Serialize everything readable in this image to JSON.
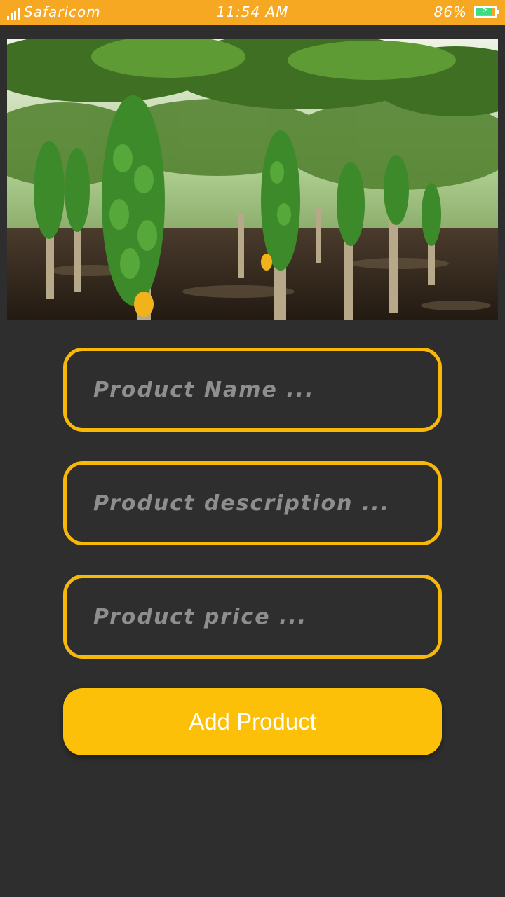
{
  "status_bar": {
    "carrier": "Safaricom",
    "time": "11:54 AM",
    "battery": "86%",
    "battery_level": 0.86,
    "background_color": "#f7a823"
  },
  "hero_image": {
    "subject": "papaya-plantation-photo"
  },
  "form": {
    "product_name_placeholder": "Product Name ...",
    "product_name_value": "",
    "product_description_placeholder": "Product description ...",
    "product_description_value": "",
    "product_price_placeholder": "Product price ...",
    "product_price_value": "",
    "submit_label": "Add Product"
  },
  "colors": {
    "background": "#2e2e2e",
    "accent_border": "#f7b80a",
    "button": "#fcc009"
  }
}
